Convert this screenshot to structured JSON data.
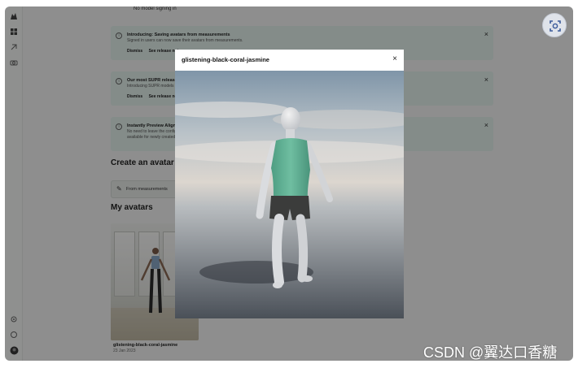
{
  "app": {
    "top_note": "No model signing in"
  },
  "banners": [
    {
      "title": "Introducing: Saving avatars from measurements",
      "desc": "Signed in users can now save their avatars from measurements.",
      "links": [
        "Dismiss",
        "See release notes"
      ]
    },
    {
      "title": "Our most SUPR release yet",
      "desc": "Introducing SUPR models",
      "links": [
        "Dismiss",
        "See release notes"
      ]
    },
    {
      "title": "Instantly Preview Alignment",
      "desc": "No need to leave the configurator to preview alignment. See release note, this feature is only",
      "desc2": "available for newly created avatars",
      "links": []
    }
  ],
  "create_section": {
    "title": "Create an avatar",
    "from_measurements_label": "From measurements"
  },
  "my_avatars": {
    "title": "My avatars",
    "cards": [
      {
        "name": "glistening-black-coral-jasmine",
        "date": "23 Jan 2023"
      }
    ]
  },
  "modal": {
    "title": "glistening-black-coral-jasmine",
    "close_symbol": "×"
  },
  "watermark": "CSDN @翼达口香糖",
  "icons": {
    "sidebar": [
      "logo-icon",
      "grid-icon",
      "tag-icon",
      "camera-icon",
      "settings-icon",
      "help-icon",
      "avatar-icon"
    ],
    "screenshot": "screenshot-icon"
  },
  "colors": {
    "banner_bg": "#e4f1ed",
    "overlay": "rgba(0,0,0,0.42)",
    "tank_top": "#5fae93",
    "shorts": "#3a3c3c"
  }
}
